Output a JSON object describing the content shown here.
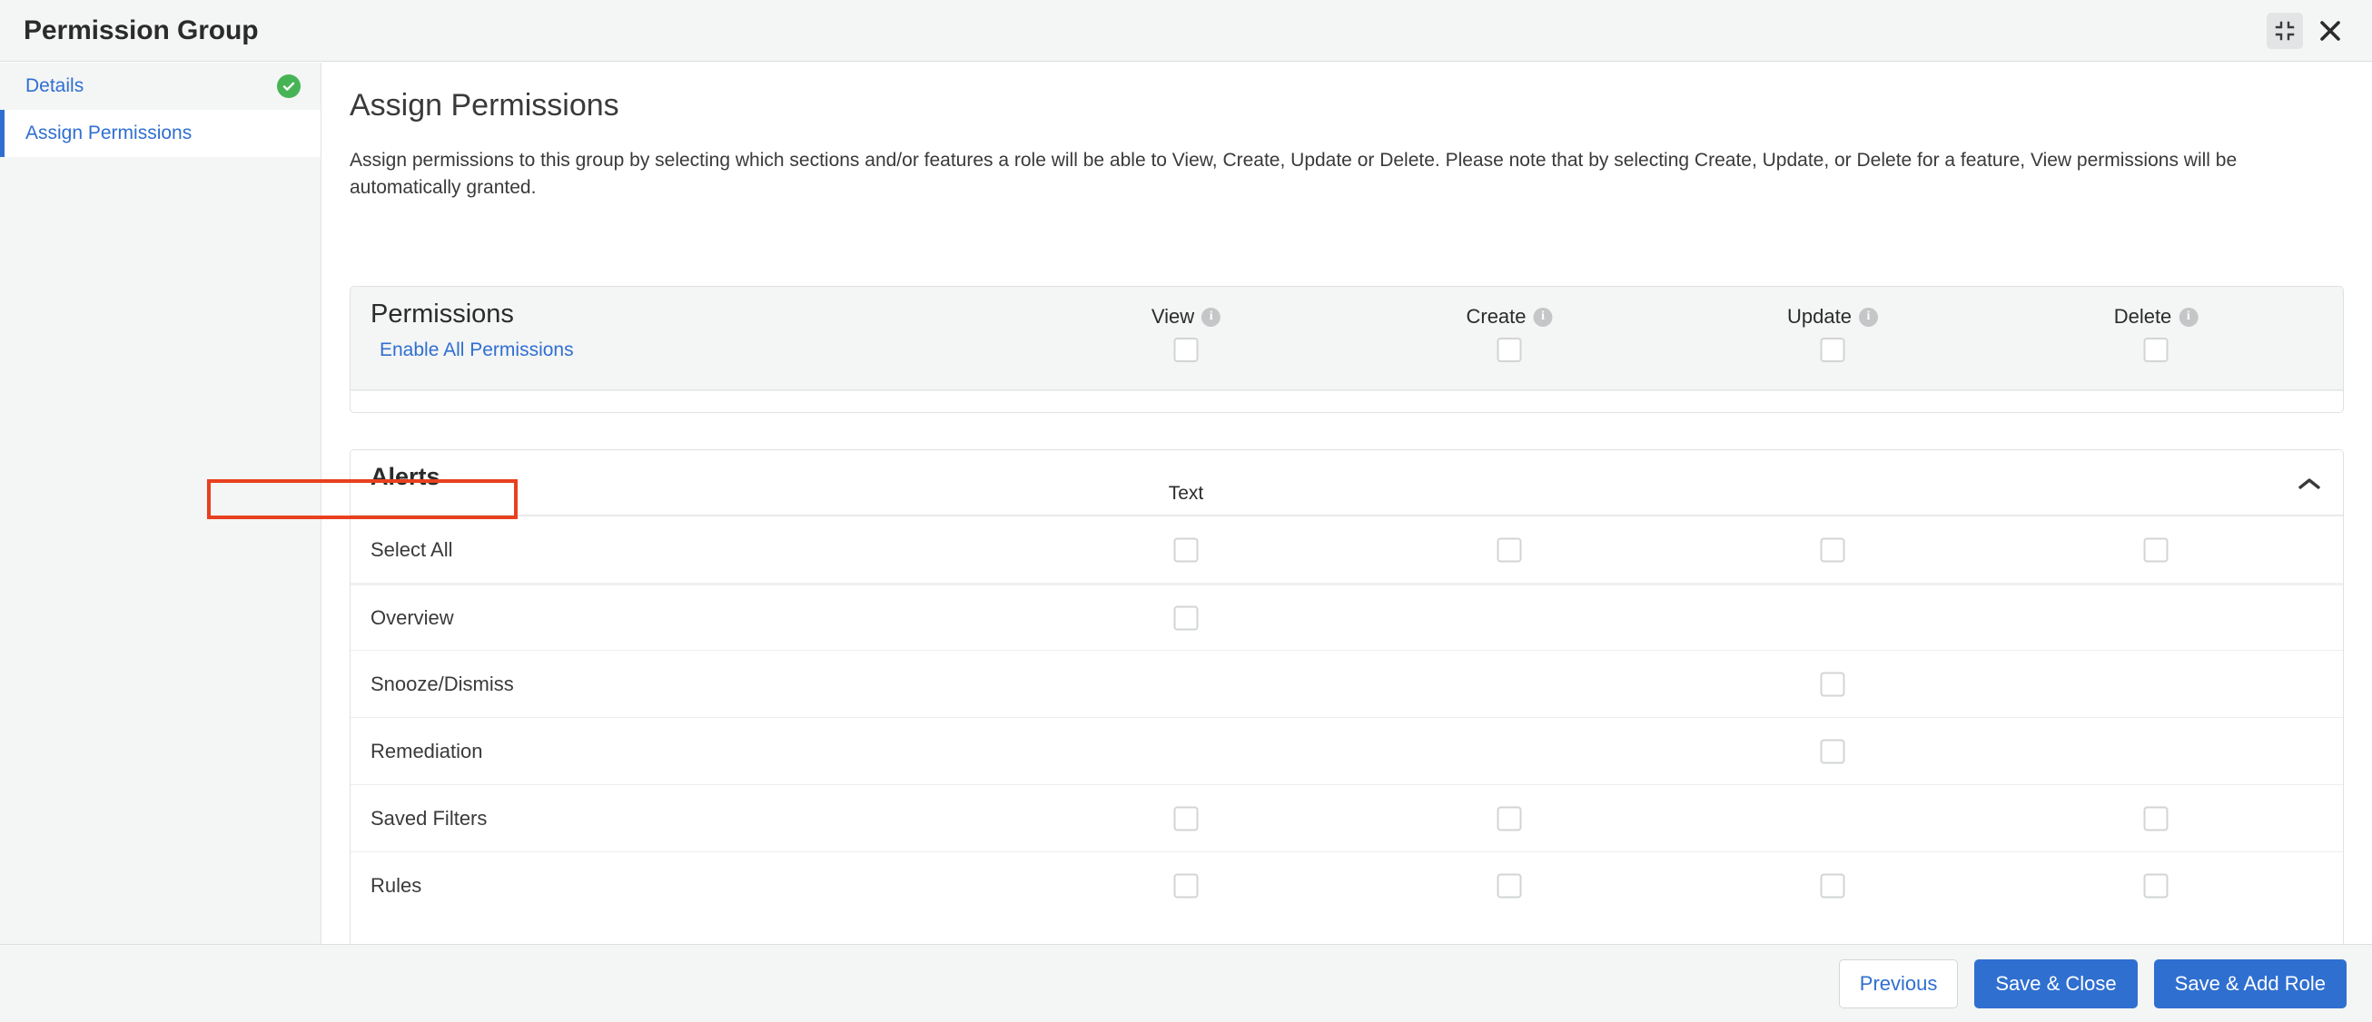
{
  "window": {
    "title": "Permission Group",
    "minimize_icon": "collapse-inward-icon",
    "close_icon": "close-icon"
  },
  "sidebar": {
    "items": [
      {
        "label": "Details",
        "active": false,
        "complete": true
      },
      {
        "label": "Assign Permissions",
        "active": true,
        "complete": false
      }
    ]
  },
  "main": {
    "title": "Assign Permissions",
    "description": "Assign permissions to this group by selecting which sections and/or features a role will be able to View, Create, Update or Delete. Please note that by selecting Create, Update, or Delete for a feature, View permissions will be automatically granted."
  },
  "permissions_card": {
    "title": "Permissions",
    "enable_all_label": "Enable All Permissions",
    "columns": [
      {
        "label": "View",
        "info_icon": "info-icon"
      },
      {
        "label": "Create",
        "info_icon": "info-icon"
      },
      {
        "label": "Update",
        "info_icon": "info-icon"
      },
      {
        "label": "Delete",
        "info_icon": "info-icon"
      }
    ],
    "header_checkboxes": [
      false,
      false,
      false,
      false
    ]
  },
  "alerts_card": {
    "title": "Alerts",
    "sublabel": "Text",
    "collapse_icon": "chevron-up-icon",
    "rows": [
      {
        "label": "Select All",
        "checkboxes": [
          true,
          true,
          true,
          true
        ],
        "checked": [
          false,
          false,
          false,
          false
        ]
      },
      {
        "label": "Overview",
        "checkboxes": [
          true,
          false,
          false,
          false
        ],
        "checked": [
          false,
          false,
          false,
          false
        ]
      },
      {
        "label": "Snooze/Dismiss",
        "checkboxes": [
          false,
          false,
          true,
          false
        ],
        "checked": [
          false,
          false,
          false,
          false
        ]
      },
      {
        "label": "Remediation",
        "checkboxes": [
          false,
          false,
          true,
          false
        ],
        "checked": [
          false,
          false,
          false,
          false
        ]
      },
      {
        "label": "Saved Filters",
        "checkboxes": [
          true,
          true,
          false,
          true
        ],
        "checked": [
          false,
          false,
          false,
          false
        ],
        "highlighted": true
      },
      {
        "label": "Rules",
        "checkboxes": [
          true,
          true,
          true,
          true
        ],
        "checked": [
          false,
          false,
          false,
          false
        ]
      }
    ]
  },
  "footer": {
    "buttons": [
      {
        "label": "Previous",
        "style": "secondary"
      },
      {
        "label": "Save & Close",
        "style": "primary"
      },
      {
        "label": "Save & Add Role",
        "style": "primary"
      }
    ]
  },
  "colors": {
    "accent": "#2f6fd0",
    "success": "#46b455",
    "highlight": "#e8401f",
    "chrome": "#f4f5f5"
  }
}
